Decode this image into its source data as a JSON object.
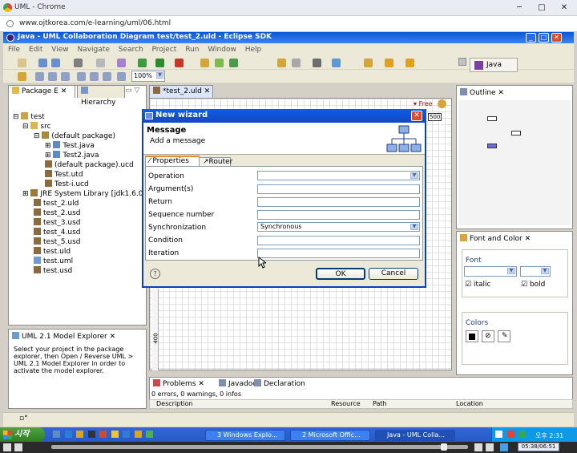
{
  "browser": {
    "title": "UML - Chrome",
    "url": "www.ojtkorea.com/e-learning/uml/06.html",
    "minimize": "─",
    "maximize": "□",
    "close": "✕"
  },
  "eclipse": {
    "title": "Java - UML Collaboration Diagram test/test_2.uld - Eclipse SDK",
    "menu": [
      "File",
      "Edit",
      "View",
      "Navigate",
      "Search",
      "Project",
      "Run",
      "Window",
      "Help"
    ],
    "zoom": "100%",
    "perspective": "Java"
  },
  "package_explorer": {
    "tabs": [
      "Package E",
      "Hierarchy"
    ],
    "tree": [
      {
        "label": "test",
        "icon": "project-icon"
      },
      {
        "label": "src",
        "icon": "folder-icon"
      },
      {
        "label": "(default package)",
        "icon": "package-icon"
      },
      {
        "label": "Test.java",
        "icon": "java-file-icon"
      },
      {
        "label": "Test2.java",
        "icon": "java-file-icon"
      },
      {
        "label": "(default package).ucd",
        "icon": "diagram-icon"
      },
      {
        "label": "Test.utd",
        "icon": "diagram-icon"
      },
      {
        "label": "Test-i.ucd",
        "icon": "diagram-icon"
      },
      {
        "label": "JRE System Library [jdk1.6.0]",
        "icon": "library-icon"
      },
      {
        "label": "test_2.uld",
        "icon": "diagram-icon"
      },
      {
        "label": "test_2.usd",
        "icon": "diagram-icon"
      },
      {
        "label": "test_3.usd",
        "icon": "diagram-icon"
      },
      {
        "label": "test_4.usd",
        "icon": "diagram-icon"
      },
      {
        "label": "test_5.usd",
        "icon": "diagram-icon"
      },
      {
        "label": "test.uld",
        "icon": "diagram-icon"
      },
      {
        "label": "test.uml",
        "icon": "diagram-icon"
      },
      {
        "label": "test.usd",
        "icon": "diagram-icon"
      }
    ]
  },
  "model_explorer": {
    "title": "UML 2.1 Model Explorer",
    "text": "Select your project in the package explorer, then Open / Reverse UML > UML 2.1 Model Explorer in order to activate the model explorer."
  },
  "editor": {
    "tab": "*test_2.uld",
    "palette_free": "Free",
    "ruler_value": "400",
    "ruler_top": "500"
  },
  "outline": {
    "title": "Outline"
  },
  "font_color": {
    "title": "Font and Color",
    "font_label": "Font",
    "italic": "italic",
    "bold": "bold",
    "colors_label": "Colors"
  },
  "bottom_panel": {
    "tabs": [
      "Problems",
      "Javadoc",
      "Declaration"
    ],
    "summary": "0 errors, 0 warnings, 0 infos",
    "columns": [
      "Description",
      "Resource",
      "Path",
      "Location"
    ]
  },
  "dialog": {
    "title": "New wizard",
    "heading": "Message",
    "subheading": "Add a message",
    "tabs": [
      "Properties",
      "Router"
    ],
    "fields": [
      {
        "label": "Operation",
        "value": "",
        "type": "select"
      },
      {
        "label": "Argument(s)",
        "value": "",
        "type": "text"
      },
      {
        "label": "Return",
        "value": "",
        "type": "text"
      },
      {
        "label": "Sequence number",
        "value": "",
        "type": "text"
      },
      {
        "label": "Synchronization",
        "value": "Synchronous",
        "type": "select"
      },
      {
        "label": "Condition",
        "value": "",
        "type": "text"
      },
      {
        "label": "Iteration",
        "value": "",
        "type": "text"
      }
    ],
    "help": "?",
    "ok": "OK",
    "cancel": "Cancel"
  },
  "taskbar": {
    "start": "시작",
    "tasks": [
      "3 Windows Explo...",
      "2 Microsoft Offic...",
      "Java - UML Colla..."
    ],
    "clock": "오후 2:31",
    "media_time": "05:38/06:51"
  }
}
